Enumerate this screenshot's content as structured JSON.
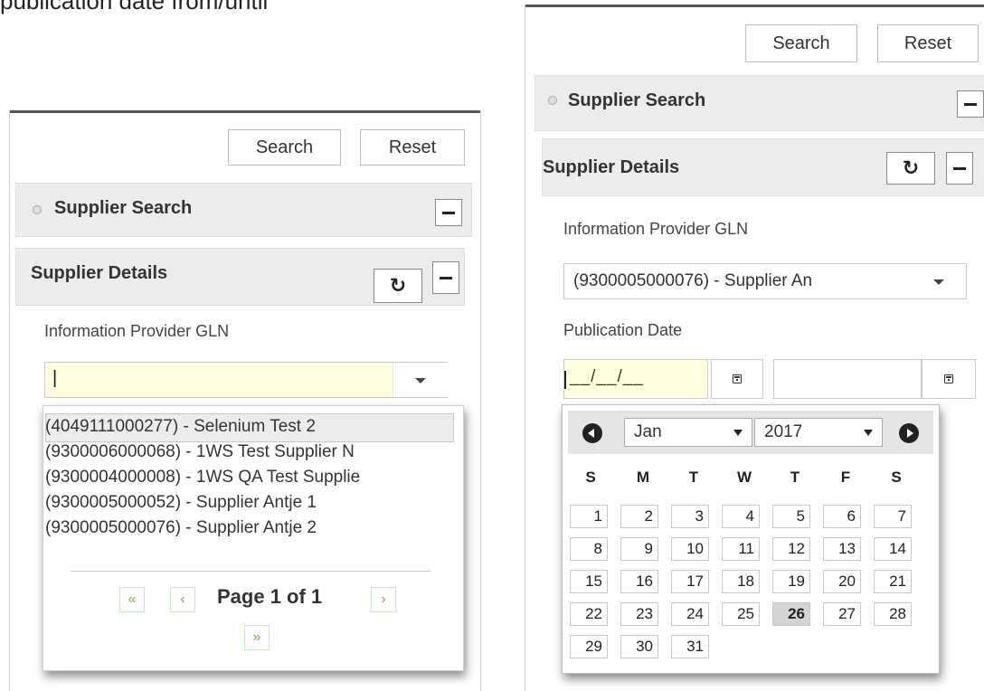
{
  "heading_fragment": "publication date from/until",
  "left": {
    "search_label": "Search",
    "reset_label": "Reset",
    "supplier_search_title": "Supplier Search",
    "supplier_details_title": "Supplier Details",
    "gln_label": "Information Provider GLN",
    "gln_value": "|",
    "options": [
      "(4049111000277) - Selenium Test 2",
      "(9300006000068) - 1WS Test Supplier N",
      "(9300004000008) - 1WS QA Test Supplie",
      "(9300005000052) - Supplier Antje 1",
      "(9300005000076) - Supplier Antje 2"
    ],
    "first_label": "«",
    "prev_label": "‹",
    "page_label": "Page 1 of 1",
    "next_label": "›",
    "last_label": "»"
  },
  "right": {
    "search_label": "Search",
    "reset_label": "Reset",
    "supplier_search_title": "Supplier Search",
    "supplier_details_title": "Supplier Details",
    "gln_label": "Information Provider GLN",
    "gln_selected": "(9300005000076) - Supplier An",
    "pub_date_label": "Publication Date",
    "date_from_placeholder": "__/__/__",
    "date_until_value": "",
    "calendar": {
      "month": "Jan",
      "year": "2017",
      "weekdays": [
        "S",
        "M",
        "T",
        "W",
        "T",
        "F",
        "S"
      ],
      "weeks": [
        [
          "1",
          "2",
          "3",
          "4",
          "5",
          "6",
          "7"
        ],
        [
          "8",
          "9",
          "10",
          "11",
          "12",
          "13",
          "14"
        ],
        [
          "15",
          "16",
          "17",
          "18",
          "19",
          "20",
          "21"
        ],
        [
          "22",
          "23",
          "24",
          "25",
          "26",
          "27",
          "28"
        ],
        [
          "29",
          "30",
          "31"
        ]
      ],
      "highlighted_day": "26"
    }
  },
  "icons": {
    "minimize": "minus-icon",
    "reset_section": "undo-icon",
    "dropdown": "caret-down-icon",
    "calendar": "calendar-icon",
    "prev_month": "circle-left-icon",
    "next_month": "circle-right-icon"
  }
}
